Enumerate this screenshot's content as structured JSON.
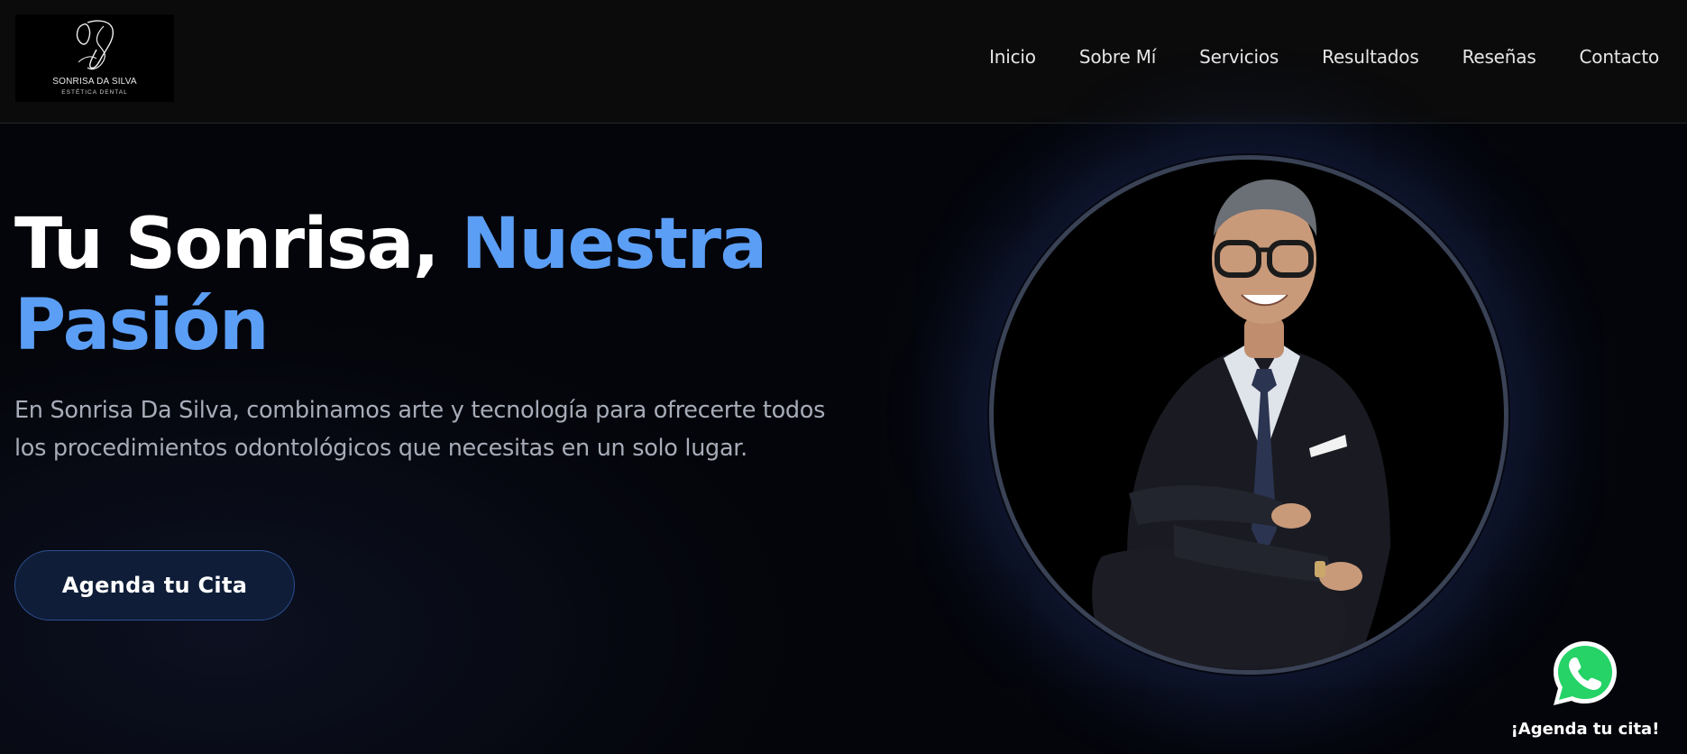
{
  "brand": {
    "name": "SONRISA DA SILVA",
    "tagline": "ESTÉTICA DENTAL",
    "monogram": "SS"
  },
  "nav": {
    "items": [
      {
        "label": "Inicio"
      },
      {
        "label": "Sobre Mí"
      },
      {
        "label": "Servicios"
      },
      {
        "label": "Resultados"
      },
      {
        "label": "Reseñas"
      },
      {
        "label": "Contacto"
      }
    ]
  },
  "hero": {
    "title_white": "Tu Sonrisa,",
    "title_blue_1": "Nuestra",
    "title_blue_2": "Pasión",
    "description": "En Sonrisa Da Silva, combinamos arte y tecnología para ofrecerte todos los procedimientos odontológicos que necesitas en un solo lugar.",
    "cta_label": "Agenda tu Cita"
  },
  "whatsapp": {
    "label": "¡Agenda tu cita!",
    "icon": "whatsapp-icon"
  },
  "colors": {
    "accent": "#5b9ef5",
    "header_bg": "#0b0b0c",
    "page_bg": "#04050a",
    "cta_bg": "#0f1d38",
    "whatsapp_green": "#25d366"
  }
}
